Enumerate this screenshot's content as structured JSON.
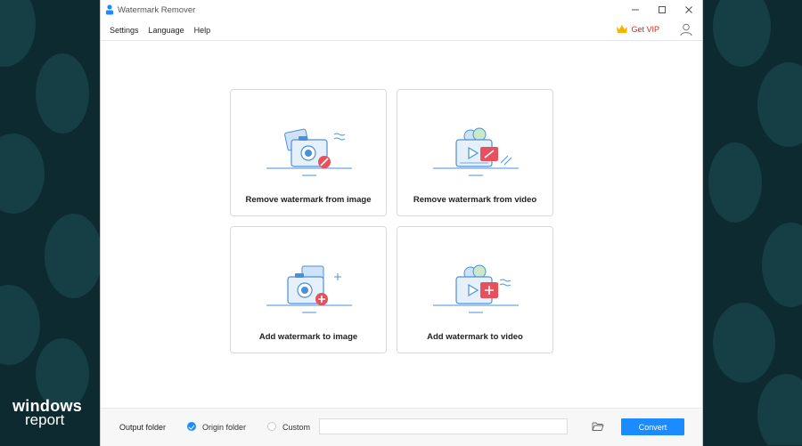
{
  "window": {
    "title": "Watermark Remover"
  },
  "menu": {
    "items": [
      "Settings",
      "Language",
      "Help"
    ]
  },
  "header": {
    "vip_label": "Get VIP"
  },
  "cards": [
    {
      "label": "Remove watermark from image",
      "icon": "remove-image-icon"
    },
    {
      "label": "Remove watermark from video",
      "icon": "remove-video-icon"
    },
    {
      "label": "Add watermark to image",
      "icon": "add-image-icon"
    },
    {
      "label": "Add watermark to video",
      "icon": "add-video-icon"
    }
  ],
  "output": {
    "label": "Output folder",
    "options": [
      {
        "label": "Origin folder",
        "selected": true
      },
      {
        "label": "Custom",
        "selected": false
      }
    ],
    "path_value": "",
    "convert_label": "Convert"
  },
  "branding": {
    "line1": "windows",
    "line2": "report"
  },
  "colors": {
    "accent": "#1a8cff",
    "vip": "#e0261b",
    "badge": "#e8505b",
    "background": "#0c2a30"
  }
}
